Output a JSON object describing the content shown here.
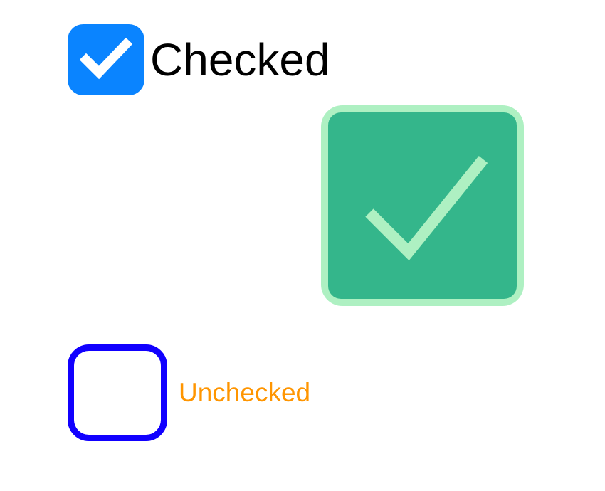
{
  "checkbox1": {
    "label": "Checked",
    "checked": true
  },
  "checkbox2": {
    "checked": true
  },
  "checkbox3": {
    "label": "Unchecked",
    "checked": false
  }
}
